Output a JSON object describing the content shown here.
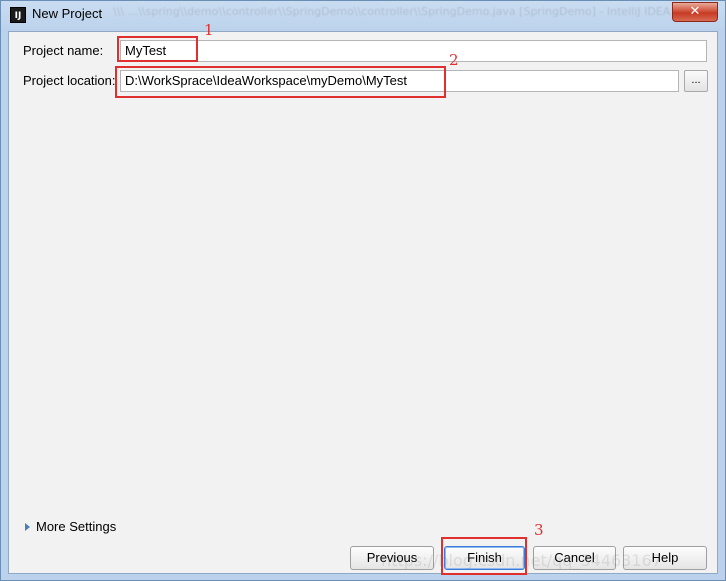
{
  "window": {
    "title": "New Project",
    "app_icon_text": "IJ",
    "close_label": "✕"
  },
  "form": {
    "project_name_label": "Project name:",
    "project_name_value": "MyTest",
    "project_location_label": "Project location:",
    "project_location_value": "D:\\WorkSprace\\IdeaWorkspace\\myDemo\\MyTest",
    "browse_label": "..."
  },
  "more_settings": {
    "label": "More Settings"
  },
  "buttons": {
    "previous": "Previous",
    "finish": "Finish",
    "cancel": "Cancel",
    "help": "Help"
  },
  "annotations": {
    "box1_number": "1",
    "box2_number": "2",
    "box3_number": "3",
    "color": "#e0302e"
  },
  "watermark": {
    "text": "https://blog.csdn.net/qq_34463167"
  }
}
